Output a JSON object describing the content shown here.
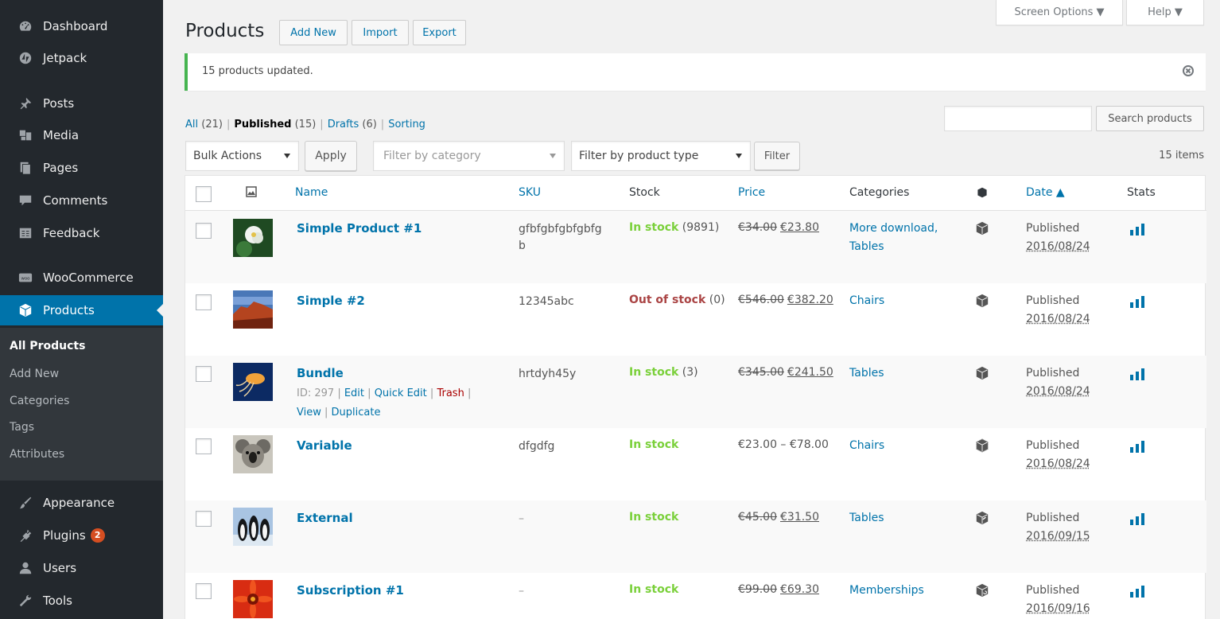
{
  "sidebar": {
    "menu": [
      {
        "label": "Dashboard",
        "icon": "dashboard-icon"
      },
      {
        "label": "Jetpack",
        "icon": "jetpack-icon"
      },
      {
        "label": "Posts",
        "icon": "pin-icon"
      },
      {
        "label": "Media",
        "icon": "media-icon"
      },
      {
        "label": "Pages",
        "icon": "pages-icon"
      },
      {
        "label": "Comments",
        "icon": "comment-icon"
      },
      {
        "label": "Feedback",
        "icon": "feedback-icon"
      },
      {
        "label": "WooCommerce",
        "icon": "woocommerce-icon"
      },
      {
        "label": "Products",
        "icon": "box-icon"
      },
      {
        "label": "Appearance",
        "icon": "brush-icon"
      },
      {
        "label": "Plugins",
        "icon": "plug-icon",
        "badge": "2"
      },
      {
        "label": "Users",
        "icon": "user-icon"
      },
      {
        "label": "Tools",
        "icon": "wrench-icon"
      }
    ],
    "submenu": [
      "All Products",
      "Add New",
      "Categories",
      "Tags",
      "Attributes"
    ]
  },
  "top_tabs": {
    "screen_options": "Screen Options ▼",
    "help": "Help ▼"
  },
  "header": {
    "title": "Products",
    "add_new": "Add New",
    "import": "Import",
    "export": "Export"
  },
  "notice": {
    "text": "15 products updated."
  },
  "views": {
    "all": "All",
    "all_count": "(21)",
    "published": "Published",
    "published_count": "(15)",
    "drafts": "Drafts",
    "drafts_count": "(6)",
    "sorting": "Sorting",
    "separator": "|"
  },
  "search": {
    "button": "Search products"
  },
  "filters": {
    "bulk_actions": "Bulk Actions",
    "apply": "Apply",
    "category_placeholder": "Filter by category",
    "product_type": "Filter by product type",
    "filter": "Filter",
    "items": "15 items"
  },
  "columns": {
    "name": "Name",
    "sku": "SKU",
    "stock": "Stock",
    "price": "Price",
    "categories": "Categories",
    "date": "Date ▲",
    "stats": "Stats"
  },
  "products": [
    {
      "name": "Simple Product #1",
      "sku": "gfbfgbfgbfgbfgb",
      "stock_status": "In stock",
      "stock_count": "(9891)",
      "price_old": "€34.00",
      "price_new": "€23.80",
      "categories": "More download, Tables",
      "date_status": "Published",
      "date": "2016/08/24"
    },
    {
      "name": "Simple #2",
      "sku": "12345abc",
      "stock_status": "Out of stock",
      "stock_count": "(0)",
      "price_old": "€546.00",
      "price_new": "€382.20",
      "categories": "Chairs",
      "date_status": "Published",
      "date": "2016/08/24"
    },
    {
      "name": "Bundle",
      "sku": "hrtdyh45y",
      "stock_status": "In stock",
      "stock_count": "(3)",
      "price_old": "€345.00",
      "price_new": "€241.50",
      "categories": "Tables",
      "date_status": "Published",
      "date": "2016/08/24",
      "row_actions": {
        "id": "ID: 297",
        "edit": "Edit",
        "quick_edit": "Quick Edit",
        "trash": "Trash",
        "view": "View",
        "duplicate": "Duplicate"
      }
    },
    {
      "name": "Variable",
      "sku": "dfgdfg",
      "stock_status": "In stock",
      "stock_count": "",
      "price_range": "€23.00 – €78.00",
      "categories": "Chairs",
      "date_status": "Published",
      "date": "2016/08/24"
    },
    {
      "name": "External",
      "sku": "–",
      "stock_status": "In stock",
      "stock_count": "",
      "price_old": "€45.00",
      "price_new": "€31.50",
      "categories": "Tables",
      "date_status": "Published",
      "date": "2016/09/15"
    },
    {
      "name": "Subscription #1",
      "sku": "–",
      "stock_status": "In stock",
      "stock_count": "",
      "price_old": "€99.00",
      "price_new": "€69.30",
      "categories": "Memberships",
      "date_status": "Published",
      "date": "2016/09/16"
    }
  ],
  "colors": {
    "sidebar_bg": "#23282d",
    "active": "#0073aa",
    "link": "#0073aa",
    "in_stock": "#7ad03a",
    "out_of_stock": "#a44",
    "notice_border": "#46b450"
  }
}
